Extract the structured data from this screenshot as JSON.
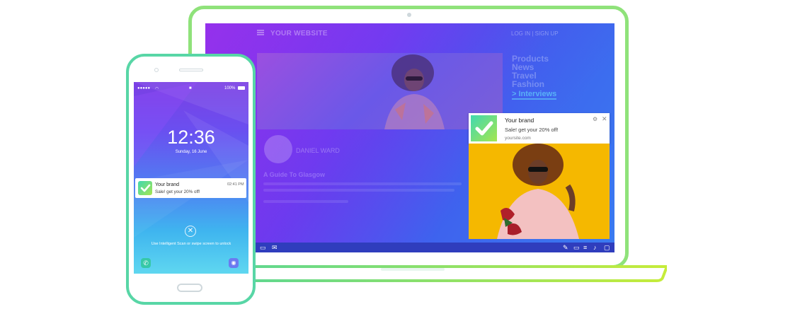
{
  "website": {
    "title": "YOUR WEBSITE",
    "login": "LOG IN  |  SIGN UP",
    "menu": [
      "Products",
      "News",
      "Travel",
      "Fashion"
    ],
    "active_menu": "> Interviews",
    "author": "DANIEL WARD",
    "article_title": "A Guide To Glasgow"
  },
  "desktop_notification": {
    "title": "Your brand",
    "body": "Sale! get your 20% off!",
    "site": "yoursite.com",
    "gear_icon": "gear-icon",
    "close_icon": "close-icon"
  },
  "phone": {
    "status_carrier": "●●●●●",
    "status_battery": "100%",
    "time": "12:36",
    "date": "Sunday, 16 June",
    "notification": {
      "title": "Your brand",
      "body": "Sale! get your 20% off!",
      "time": "02:41 PM"
    },
    "unlock_text": "Use Intelligent Scan or swipe screen to unlock"
  },
  "colors": {
    "accent_green": "#a7ea52",
    "accent_teal": "#49d3a3",
    "screen_purple": "#8a2be2",
    "screen_blue": "#3a7bf0",
    "taskbar": "#2f3dbd"
  }
}
